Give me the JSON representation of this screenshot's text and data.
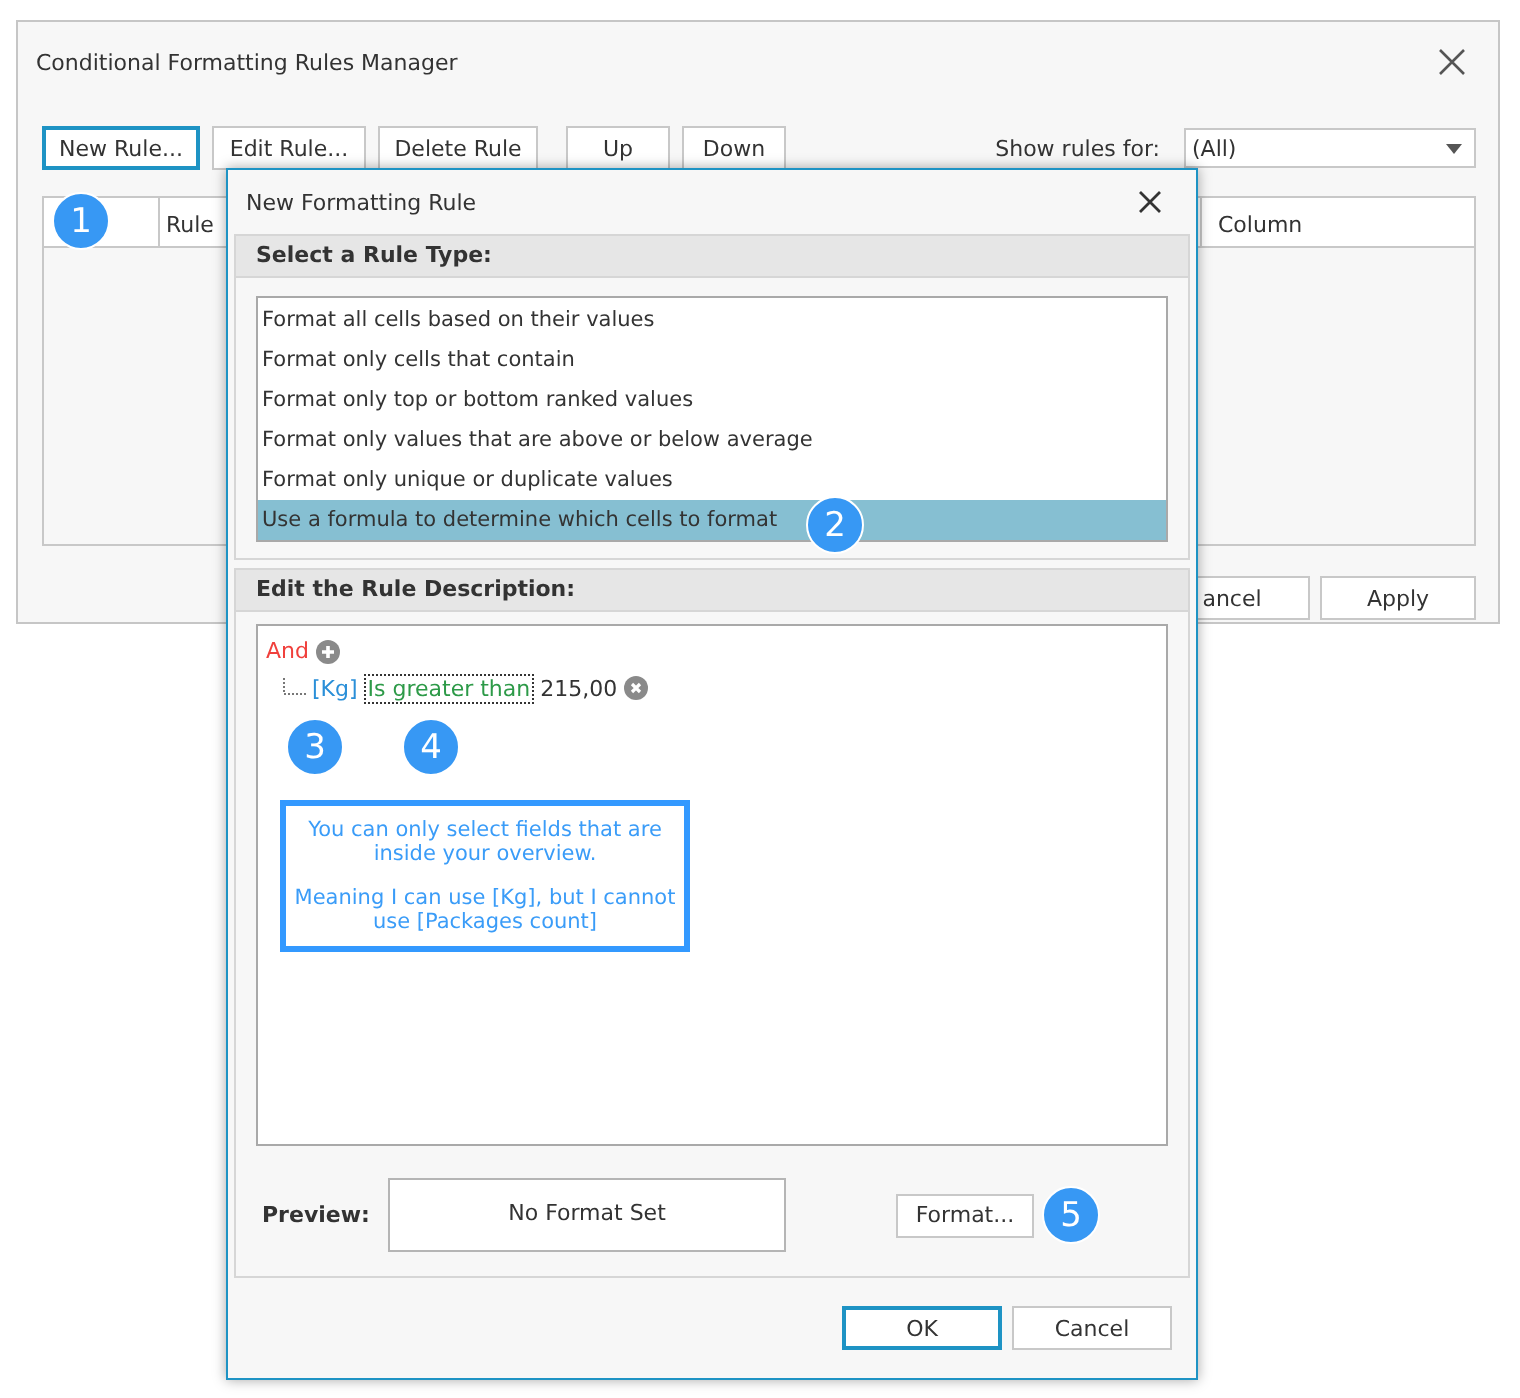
{
  "manager": {
    "title": "Conditional Formatting Rules Manager",
    "toolbar": [
      {
        "label": "New Rule...",
        "focused": true
      },
      {
        "label": "Edit Rule...",
        "focused": false
      },
      {
        "label": "Delete Rule",
        "focused": false
      },
      {
        "label": "Up",
        "focused": false
      },
      {
        "label": "Down",
        "focused": false
      }
    ],
    "show_rules_label": "Show rules for:",
    "show_rules_value": "(All)",
    "columns": [
      "Rule",
      "Column"
    ],
    "buttons": [
      "ancel",
      "Apply"
    ]
  },
  "dialog": {
    "title": "New Formatting Rule",
    "rule_type_header": "Select a Rule Type:",
    "rule_types": [
      {
        "label": "Format all cells based on their values",
        "selected": false
      },
      {
        "label": "Format only cells that contain",
        "selected": false
      },
      {
        "label": "Format only top or bottom ranked values",
        "selected": false
      },
      {
        "label": "Format only values that are above or below average",
        "selected": false
      },
      {
        "label": "Format only unique or duplicate values",
        "selected": false
      },
      {
        "label": "Use a formula to determine which cells to format",
        "selected": true
      }
    ],
    "description_header": "Edit the Rule Description:",
    "group_operator": "And",
    "condition": {
      "field": "[Kg]",
      "operator": "Is greater than",
      "value": "215,00"
    },
    "note": [
      "You can only select fields that are inside your overview.",
      "Meaning I can use [Kg], but I cannot use [Packages count]"
    ],
    "preview_label": "Preview:",
    "preview_text": "No Format Set",
    "format_button": "Format...",
    "buttons": [
      {
        "label": "OK",
        "focused": true
      },
      {
        "label": "Cancel",
        "focused": false
      }
    ]
  },
  "callouts": [
    "1",
    "2",
    "3",
    "4",
    "5"
  ]
}
